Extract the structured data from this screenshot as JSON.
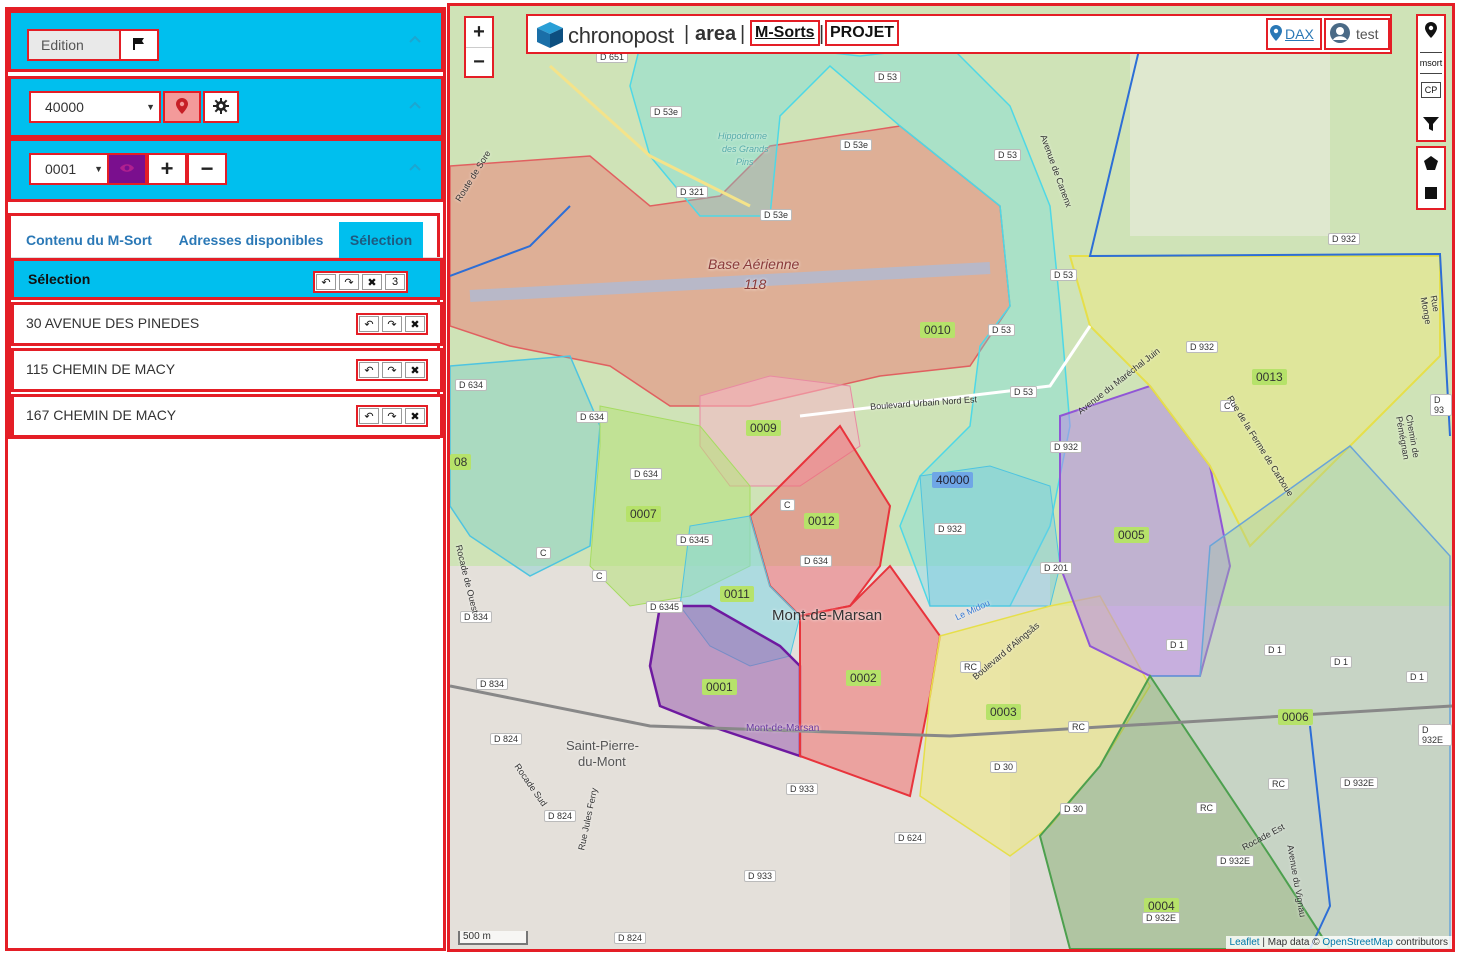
{
  "left": {
    "edition_label": "Edition",
    "zone_select_value": "40000",
    "msort_select_value": "0001",
    "msort_color": "#7a0f8e",
    "tabs": [
      {
        "label": "Contenu du M-Sort"
      },
      {
        "label": "Adresses disponibles"
      },
      {
        "label": "Sélection",
        "active": true
      }
    ],
    "selection": {
      "title": "Sélection",
      "count": "3",
      "items": [
        {
          "label": "30 AVENUE DES PINEDES"
        },
        {
          "label": "115 CHEMIN DE MACY"
        },
        {
          "label": "167 CHEMIN DE MACY"
        }
      ]
    }
  },
  "topbar": {
    "brand": "chronopost",
    "separator": "|",
    "area": "area",
    "msorts": "M-Sorts",
    "projet": "PROJET",
    "city": "DAX",
    "user": "test"
  },
  "map": {
    "zoom_in": "+",
    "zoom_out": "−",
    "tools": {
      "msort": "msort",
      "cp": "CP"
    },
    "zones": [
      {
        "label": "0010",
        "color": "#f0a0a0"
      },
      {
        "label": "0009",
        "color": "#f7b7c8"
      },
      {
        "label": "0007",
        "color": "#b7e27a"
      },
      {
        "label": "0012",
        "color": "#f08080"
      },
      {
        "label": "0011",
        "color": "#7fd7e6"
      },
      {
        "label": "0001",
        "color": "#9b5fb0"
      },
      {
        "label": "0002",
        "color": "#f07070"
      },
      {
        "label": "0003",
        "color": "#eeea7a"
      },
      {
        "label": "0005",
        "color": "#b48ae6"
      },
      {
        "label": "0013",
        "color": "#f0ea80"
      },
      {
        "label": "0006",
        "color": "#9ecfa6"
      },
      {
        "label": "0004",
        "color": "#9fcc80"
      },
      {
        "label": "40000",
        "color": "#6fa6e6"
      },
      {
        "label": "08",
        "color": "#b7e27a"
      }
    ],
    "places": [
      "Base Aérienne",
      "118",
      "Mont-de-Marsan",
      "Saint-Pierre-",
      "du-Mont",
      "Hippodrome",
      "des Grands",
      "Pins",
      "Mont-de-Marsan"
    ],
    "roads": [
      "D 651",
      "D 53",
      "D 53e",
      "D 53e",
      "D 321",
      "D 53e",
      "D 53",
      "D 53",
      "D 53",
      "D 53",
      "D 932",
      "D 932",
      "D 932",
      "D 634",
      "D 634",
      "D 634",
      "D 6345",
      "D 6345",
      "D 634",
      "D 834",
      "D 834",
      "D 824",
      "D 824",
      "D 933",
      "D 933",
      "D 624",
      "D 824",
      "D 932",
      "D 201",
      "D 1",
      "D 1",
      "D 1",
      "D 1",
      "D 30",
      "D 30",
      "D 932E",
      "D 932E",
      "D 932E",
      "D 932E",
      "RC",
      "RC",
      "RC",
      "RC",
      "C",
      "C",
      "C",
      "C",
      "D 93"
    ],
    "road_names": [
      "Boulevard Urbain Nord Est",
      "Route de Sore",
      "Avenue de Canenx",
      "Avenue du Maréchal Juin",
      "Rue de la Ferme de Carboue",
      "Chemin de Pémégnan",
      "Rue Monge",
      "Boulevard d'Alingsås",
      "Rocade Est",
      "Avenue du Vignau",
      "Rocade Sud",
      "Rue Jules Ferry",
      "Rocade de Ouest",
      "Le Midou"
    ],
    "scale": "500 m",
    "attribution": {
      "leaflet": "Leaflet",
      "mid": " | Map data © ",
      "osm": "OpenStreetMap",
      "end": " contributors"
    }
  }
}
